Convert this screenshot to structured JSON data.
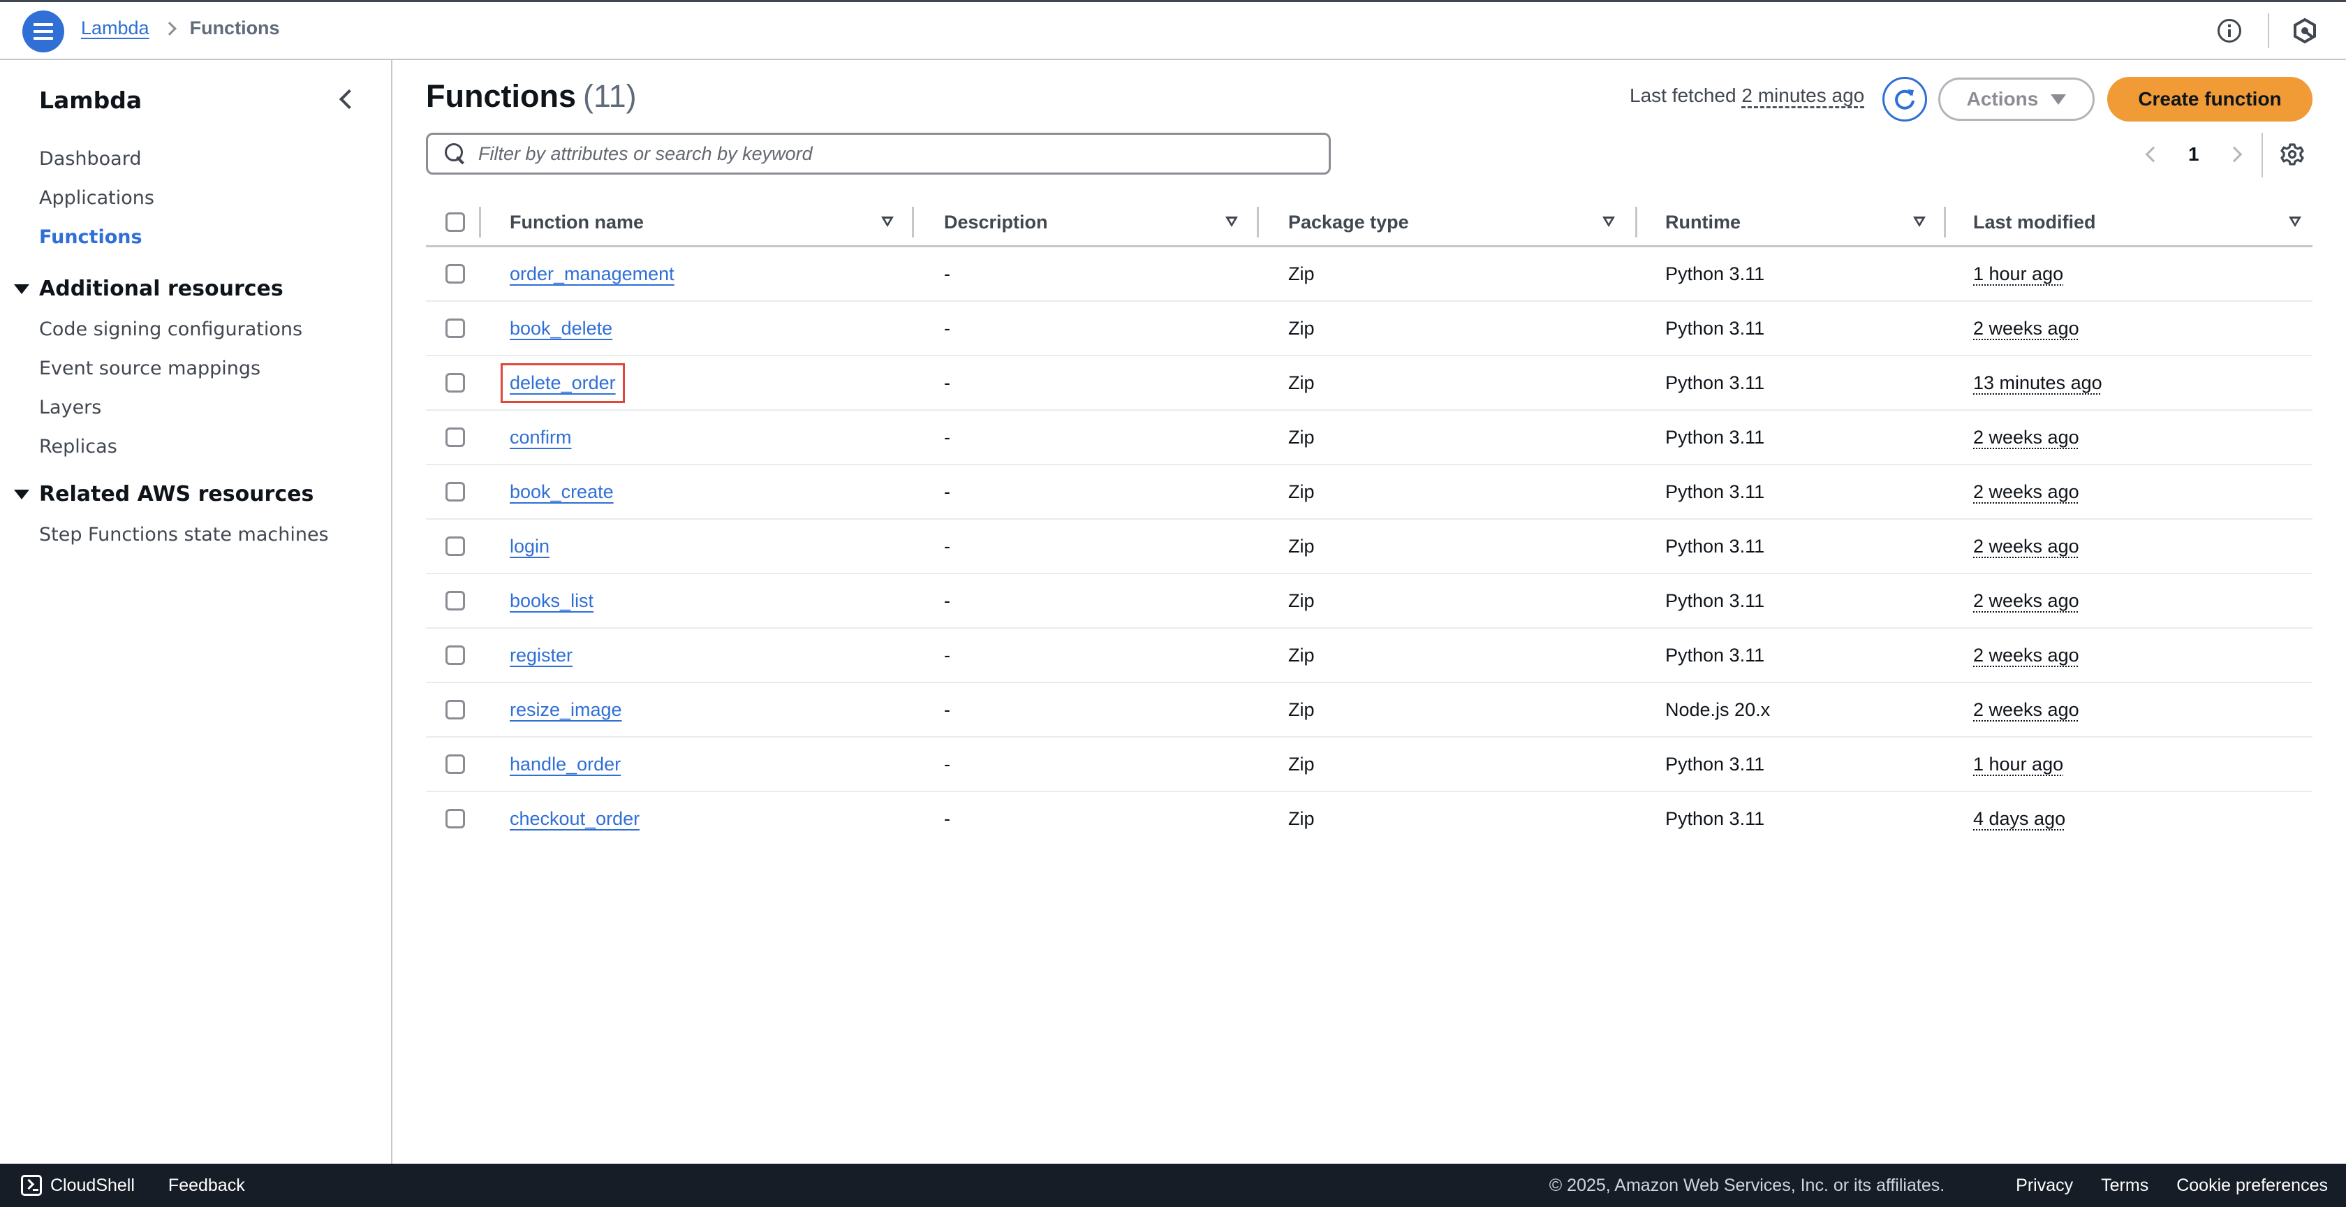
{
  "topbar": {
    "breadcrumb": {
      "parent": "Lambda",
      "current": "Functions"
    },
    "icons": [
      "menu-icon",
      "info-icon",
      "notifications-hex-icon"
    ]
  },
  "sidebar": {
    "title": "Lambda",
    "items": [
      {
        "label": "Dashboard",
        "active": false
      },
      {
        "label": "Applications",
        "active": false
      },
      {
        "label": "Functions",
        "active": true
      }
    ],
    "sections": [
      {
        "label": "Additional resources",
        "expanded": true,
        "items": [
          "Code signing configurations",
          "Event source mappings",
          "Layers",
          "Replicas"
        ]
      },
      {
        "label": "Related AWS resources",
        "expanded": true,
        "items": [
          "Step Functions state machines"
        ]
      }
    ]
  },
  "main": {
    "title": "Functions",
    "count": "(11)",
    "last_fetched_label": "Last fetched",
    "last_fetched_value": "2 minutes ago",
    "actions_label": "Actions",
    "create_label": "Create function",
    "search_placeholder": "Filter by attributes or search by keyword",
    "search_value": "",
    "pagination": {
      "current_page": "1"
    },
    "table": {
      "columns": [
        "Function name",
        "Description",
        "Package type",
        "Runtime",
        "Last modified"
      ],
      "rows": [
        {
          "name": "order_management",
          "description": "-",
          "package": "Zip",
          "runtime": "Python 3.11",
          "modified": "1 hour ago"
        },
        {
          "name": "book_delete",
          "description": "-",
          "package": "Zip",
          "runtime": "Python 3.11",
          "modified": "2 weeks ago"
        },
        {
          "name": "delete_order",
          "description": "-",
          "package": "Zip",
          "runtime": "Python 3.11",
          "modified": "13 minutes ago",
          "highlighted": true
        },
        {
          "name": "confirm",
          "description": "-",
          "package": "Zip",
          "runtime": "Python 3.11",
          "modified": "2 weeks ago"
        },
        {
          "name": "book_create",
          "description": "-",
          "package": "Zip",
          "runtime": "Python 3.11",
          "modified": "2 weeks ago"
        },
        {
          "name": "login",
          "description": "-",
          "package": "Zip",
          "runtime": "Python 3.11",
          "modified": "2 weeks ago"
        },
        {
          "name": "books_list",
          "description": "-",
          "package": "Zip",
          "runtime": "Python 3.11",
          "modified": "2 weeks ago"
        },
        {
          "name": "register",
          "description": "-",
          "package": "Zip",
          "runtime": "Python 3.11",
          "modified": "2 weeks ago"
        },
        {
          "name": "resize_image",
          "description": "-",
          "package": "Zip",
          "runtime": "Node.js 20.x",
          "modified": "2 weeks ago"
        },
        {
          "name": "handle_order",
          "description": "-",
          "package": "Zip",
          "runtime": "Python 3.11",
          "modified": "1 hour ago"
        },
        {
          "name": "checkout_order",
          "description": "-",
          "package": "Zip",
          "runtime": "Python 3.11",
          "modified": "4 days ago"
        }
      ]
    }
  },
  "footer": {
    "cloudshell": "CloudShell",
    "feedback": "Feedback",
    "copyright": "© 2025, Amazon Web Services, Inc. or its affiliates.",
    "links": [
      "Privacy",
      "Terms",
      "Cookie preferences"
    ]
  },
  "colors": {
    "accent": "#2f6fd6",
    "primary_button": "#f09b36",
    "footer_bg": "#161d26",
    "highlight_outline": "#e0463a"
  }
}
